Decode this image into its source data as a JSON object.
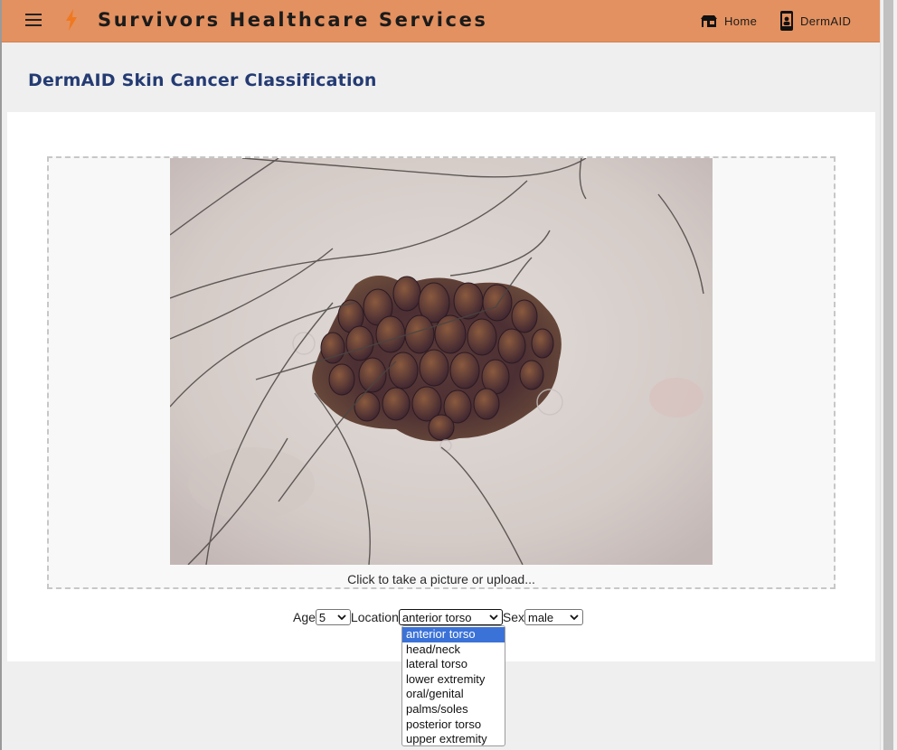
{
  "app": {
    "brand": "Survivors Healthcare Services"
  },
  "nav": {
    "home_label": "Home",
    "dermaid_label": "DermAID"
  },
  "page": {
    "title": "DermAID Skin Cancer Classification"
  },
  "upload": {
    "hint": "Click to take a picture or upload..."
  },
  "form": {
    "age_label": "Age",
    "age_value": "5",
    "location_label": "Location",
    "location_value": "anterior torso",
    "sex_label": "Sex",
    "sex_value": "male"
  },
  "location_options": [
    "anterior torso",
    "head/neck",
    "lateral torso",
    "lower extremity",
    "oral/genital",
    "palms/soles",
    "posterior torso",
    "upper extremity"
  ],
  "colors": {
    "topbar": "#e39160",
    "title": "#243b73",
    "selected_option": "#3b72d8"
  },
  "icons": {
    "menu": "menu-icon",
    "brand": "lightning-bolt-icon",
    "home": "home-icon",
    "dermaid": "phone-icon"
  }
}
